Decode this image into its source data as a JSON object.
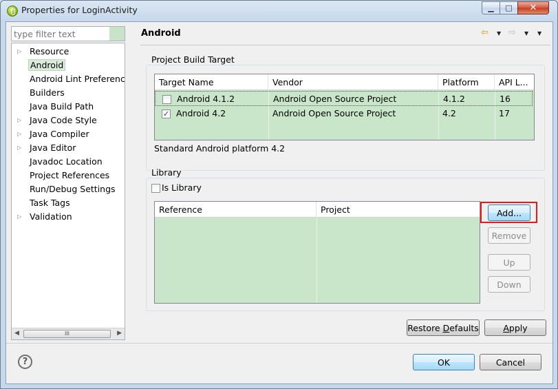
{
  "window": {
    "title": "Properties for LoginActivity",
    "minimize_glyph": "▁",
    "maximize_glyph": "□",
    "close_glyph": "✕"
  },
  "filter": {
    "placeholder": "type filter text"
  },
  "tree": {
    "items": [
      {
        "label": "Resource",
        "expandable": true
      },
      {
        "label": "Android",
        "expandable": false,
        "selected": true
      },
      {
        "label": "Android Lint Preferences",
        "expandable": false
      },
      {
        "label": "Builders",
        "expandable": false
      },
      {
        "label": "Java Build Path",
        "expandable": false
      },
      {
        "label": "Java Code Style",
        "expandable": true
      },
      {
        "label": "Java Compiler",
        "expandable": true
      },
      {
        "label": "Java Editor",
        "expandable": true
      },
      {
        "label": "Javadoc Location",
        "expandable": false
      },
      {
        "label": "Project References",
        "expandable": false
      },
      {
        "label": "Run/Debug Settings",
        "expandable": false
      },
      {
        "label": "Task Tags",
        "expandable": false
      },
      {
        "label": "Validation",
        "expandable": true
      }
    ],
    "scroll_left": "◀",
    "scroll_thumb": "III",
    "scroll_right": "▶"
  },
  "page": {
    "title": "Android",
    "nav": {
      "back": "⇦",
      "dropdown": "▼",
      "forward": "⇨",
      "menu": "▼"
    }
  },
  "build_target": {
    "group_label": "Project Build Target",
    "columns": [
      "Target Name",
      "Vendor",
      "Platform",
      "API L..."
    ],
    "rows": [
      {
        "checked": false,
        "name": "Android 4.1.2",
        "vendor": "Android Open Source Project",
        "platform": "4.1.2",
        "api": "16"
      },
      {
        "checked": true,
        "name": "Android 4.2",
        "vendor": "Android Open Source Project",
        "platform": "4.2",
        "api": "17"
      }
    ],
    "check_mark": "✓",
    "description": "Standard Android platform 4.2"
  },
  "library": {
    "group_label": "Library",
    "is_library_label": "Is Library",
    "is_library_checked": false,
    "columns": [
      "Reference",
      "Project"
    ],
    "add_label": "Add...",
    "remove_label": "Remove",
    "up_label": "Up",
    "down_label": "Down"
  },
  "buttons": {
    "restore_pre": "Restore ",
    "restore_u": "D",
    "restore_post": "efaults",
    "apply_u": "A",
    "apply_post": "pply",
    "ok": "OK",
    "cancel": "Cancel",
    "help": "?"
  },
  "colors": {
    "table_background": "#cae6ca",
    "highlight_border": "#e6191b"
  }
}
